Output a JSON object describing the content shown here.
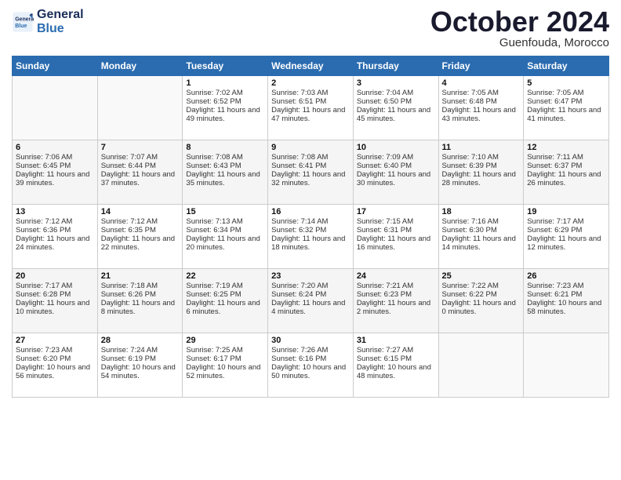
{
  "logo": {
    "line1": "General",
    "line2": "Blue"
  },
  "title": "October 2024",
  "subtitle": "Guenfouda, Morocco",
  "headers": [
    "Sunday",
    "Monday",
    "Tuesday",
    "Wednesday",
    "Thursday",
    "Friday",
    "Saturday"
  ],
  "weeks": [
    [
      {
        "day": "",
        "content": ""
      },
      {
        "day": "",
        "content": ""
      },
      {
        "day": "1",
        "content": "Sunrise: 7:02 AM\nSunset: 6:52 PM\nDaylight: 11 hours and 49 minutes."
      },
      {
        "day": "2",
        "content": "Sunrise: 7:03 AM\nSunset: 6:51 PM\nDaylight: 11 hours and 47 minutes."
      },
      {
        "day": "3",
        "content": "Sunrise: 7:04 AM\nSunset: 6:50 PM\nDaylight: 11 hours and 45 minutes."
      },
      {
        "day": "4",
        "content": "Sunrise: 7:05 AM\nSunset: 6:48 PM\nDaylight: 11 hours and 43 minutes."
      },
      {
        "day": "5",
        "content": "Sunrise: 7:05 AM\nSunset: 6:47 PM\nDaylight: 11 hours and 41 minutes."
      }
    ],
    [
      {
        "day": "6",
        "content": "Sunrise: 7:06 AM\nSunset: 6:45 PM\nDaylight: 11 hours and 39 minutes."
      },
      {
        "day": "7",
        "content": "Sunrise: 7:07 AM\nSunset: 6:44 PM\nDaylight: 11 hours and 37 minutes."
      },
      {
        "day": "8",
        "content": "Sunrise: 7:08 AM\nSunset: 6:43 PM\nDaylight: 11 hours and 35 minutes."
      },
      {
        "day": "9",
        "content": "Sunrise: 7:08 AM\nSunset: 6:41 PM\nDaylight: 11 hours and 32 minutes."
      },
      {
        "day": "10",
        "content": "Sunrise: 7:09 AM\nSunset: 6:40 PM\nDaylight: 11 hours and 30 minutes."
      },
      {
        "day": "11",
        "content": "Sunrise: 7:10 AM\nSunset: 6:39 PM\nDaylight: 11 hours and 28 minutes."
      },
      {
        "day": "12",
        "content": "Sunrise: 7:11 AM\nSunset: 6:37 PM\nDaylight: 11 hours and 26 minutes."
      }
    ],
    [
      {
        "day": "13",
        "content": "Sunrise: 7:12 AM\nSunset: 6:36 PM\nDaylight: 11 hours and 24 minutes."
      },
      {
        "day": "14",
        "content": "Sunrise: 7:12 AM\nSunset: 6:35 PM\nDaylight: 11 hours and 22 minutes."
      },
      {
        "day": "15",
        "content": "Sunrise: 7:13 AM\nSunset: 6:34 PM\nDaylight: 11 hours and 20 minutes."
      },
      {
        "day": "16",
        "content": "Sunrise: 7:14 AM\nSunset: 6:32 PM\nDaylight: 11 hours and 18 minutes."
      },
      {
        "day": "17",
        "content": "Sunrise: 7:15 AM\nSunset: 6:31 PM\nDaylight: 11 hours and 16 minutes."
      },
      {
        "day": "18",
        "content": "Sunrise: 7:16 AM\nSunset: 6:30 PM\nDaylight: 11 hours and 14 minutes."
      },
      {
        "day": "19",
        "content": "Sunrise: 7:17 AM\nSunset: 6:29 PM\nDaylight: 11 hours and 12 minutes."
      }
    ],
    [
      {
        "day": "20",
        "content": "Sunrise: 7:17 AM\nSunset: 6:28 PM\nDaylight: 11 hours and 10 minutes."
      },
      {
        "day": "21",
        "content": "Sunrise: 7:18 AM\nSunset: 6:26 PM\nDaylight: 11 hours and 8 minutes."
      },
      {
        "day": "22",
        "content": "Sunrise: 7:19 AM\nSunset: 6:25 PM\nDaylight: 11 hours and 6 minutes."
      },
      {
        "day": "23",
        "content": "Sunrise: 7:20 AM\nSunset: 6:24 PM\nDaylight: 11 hours and 4 minutes."
      },
      {
        "day": "24",
        "content": "Sunrise: 7:21 AM\nSunset: 6:23 PM\nDaylight: 11 hours and 2 minutes."
      },
      {
        "day": "25",
        "content": "Sunrise: 7:22 AM\nSunset: 6:22 PM\nDaylight: 11 hours and 0 minutes."
      },
      {
        "day": "26",
        "content": "Sunrise: 7:23 AM\nSunset: 6:21 PM\nDaylight: 10 hours and 58 minutes."
      }
    ],
    [
      {
        "day": "27",
        "content": "Sunrise: 7:23 AM\nSunset: 6:20 PM\nDaylight: 10 hours and 56 minutes."
      },
      {
        "day": "28",
        "content": "Sunrise: 7:24 AM\nSunset: 6:19 PM\nDaylight: 10 hours and 54 minutes."
      },
      {
        "day": "29",
        "content": "Sunrise: 7:25 AM\nSunset: 6:17 PM\nDaylight: 10 hours and 52 minutes."
      },
      {
        "day": "30",
        "content": "Sunrise: 7:26 AM\nSunset: 6:16 PM\nDaylight: 10 hours and 50 minutes."
      },
      {
        "day": "31",
        "content": "Sunrise: 7:27 AM\nSunset: 6:15 PM\nDaylight: 10 hours and 48 minutes."
      },
      {
        "day": "",
        "content": ""
      },
      {
        "day": "",
        "content": ""
      }
    ]
  ]
}
